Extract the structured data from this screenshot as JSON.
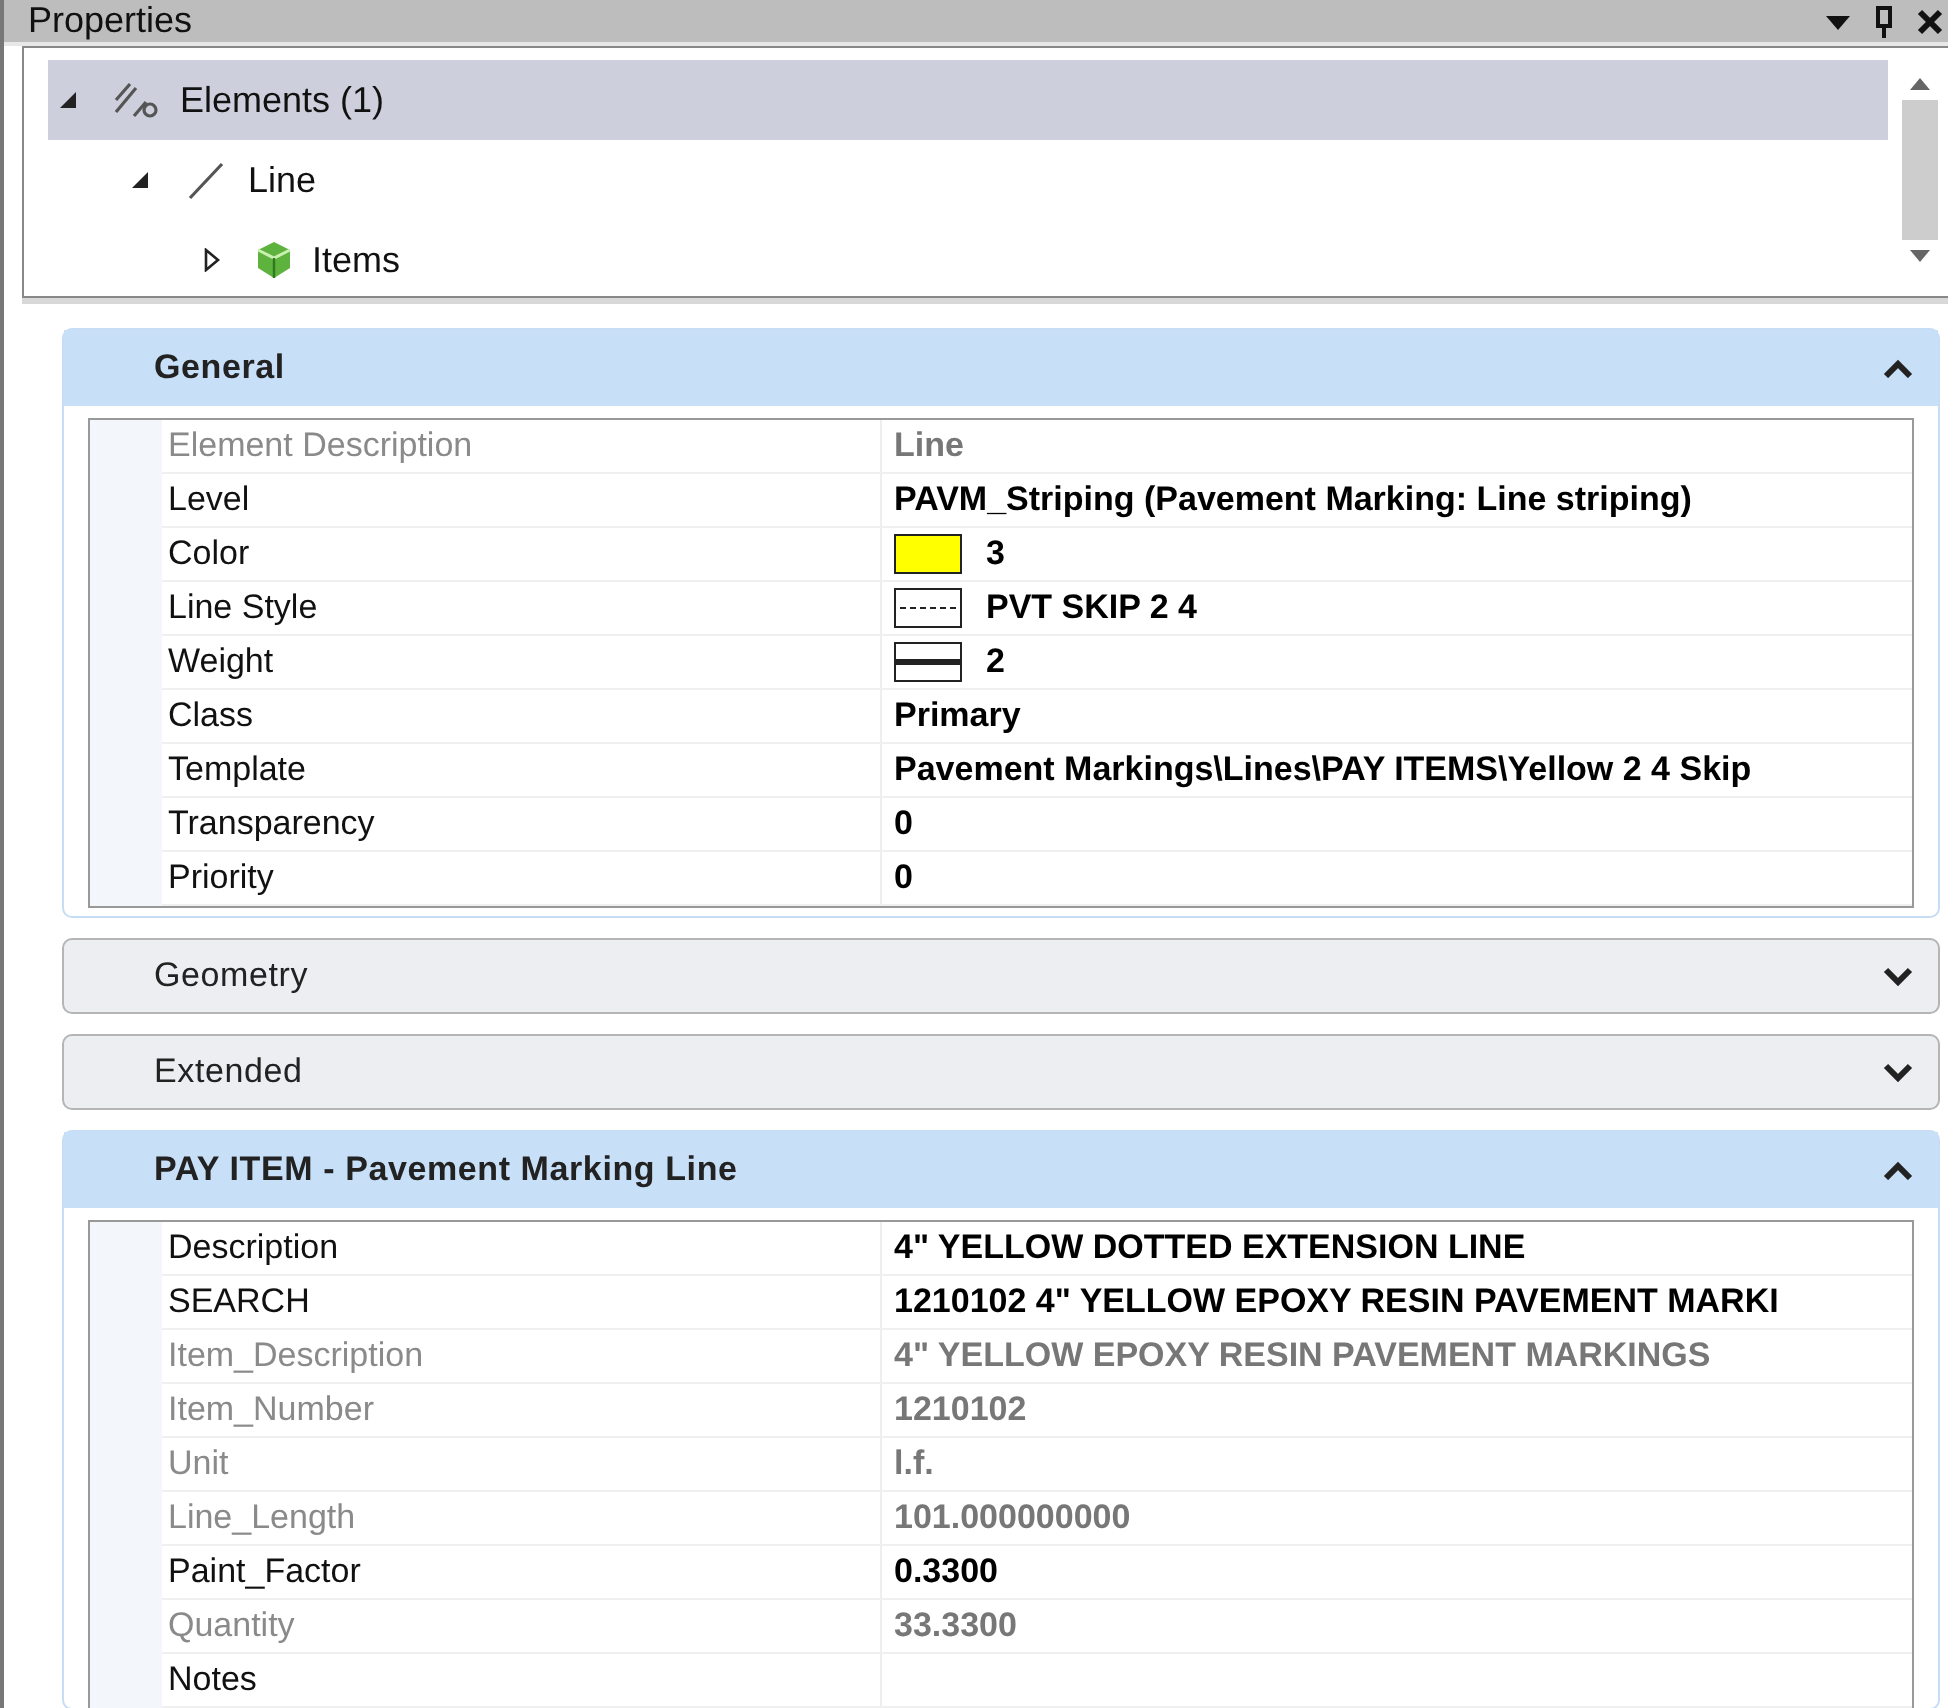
{
  "window": {
    "title": "Properties"
  },
  "tree": [
    {
      "label": "Elements (1)",
      "expanded": true,
      "selected": true,
      "children": [
        {
          "label": "Line",
          "expanded": true,
          "selected": false,
          "children": [
            {
              "label": "Items",
              "expanded": false,
              "selected": false
            }
          ]
        }
      ]
    }
  ],
  "sections": [
    {
      "title": "General",
      "expanded": true,
      "rows": [
        {
          "kind": "text",
          "name": "Element Description",
          "value": "Line",
          "disabled": true
        },
        {
          "kind": "text",
          "name": "Level",
          "value": "PAVM_Striping (Pavement Marking: Line striping)",
          "disabled": false
        },
        {
          "kind": "color",
          "name": "Color",
          "value": "3",
          "color": "#ffff00",
          "disabled": false
        },
        {
          "kind": "linestyle",
          "name": "Line Style",
          "value": "PVT SKIP 2 4",
          "disabled": false
        },
        {
          "kind": "weight",
          "name": "Weight",
          "value": "2",
          "disabled": false
        },
        {
          "kind": "text",
          "name": "Class",
          "value": "Primary",
          "disabled": false
        },
        {
          "kind": "text",
          "name": "Template",
          "value": "Pavement Markings\\Lines\\PAY ITEMS\\Yellow 2 4 Skip",
          "disabled": false
        },
        {
          "kind": "text",
          "name": "Transparency",
          "value": "0",
          "disabled": false
        },
        {
          "kind": "text",
          "name": "Priority",
          "value": "0",
          "disabled": false
        }
      ]
    },
    {
      "title": "Geometry",
      "expanded": false
    },
    {
      "title": "Extended",
      "expanded": false
    },
    {
      "title": "PAY ITEM - Pavement Marking Line",
      "expanded": true,
      "rows": [
        {
          "kind": "text",
          "name": "Description",
          "value": "4\" YELLOW DOTTED EXTENSION LINE",
          "disabled": false
        },
        {
          "kind": "text",
          "name": "SEARCH",
          "value": "1210102 4\" YELLOW EPOXY RESIN PAVEMENT MARKI",
          "disabled": false
        },
        {
          "kind": "text",
          "name": "Item_Description",
          "value": "4\" YELLOW EPOXY RESIN PAVEMENT MARKINGS",
          "disabled": true
        },
        {
          "kind": "text",
          "name": "Item_Number",
          "value": "1210102",
          "disabled": true
        },
        {
          "kind": "text",
          "name": "Unit",
          "value": "l.f.",
          "disabled": true
        },
        {
          "kind": "text",
          "name": "Line_Length",
          "value": "101.000000000",
          "disabled": true
        },
        {
          "kind": "text",
          "name": "Paint_Factor",
          "value": "0.3300",
          "disabled": false
        },
        {
          "kind": "text",
          "name": "Quantity",
          "value": "33.3300",
          "disabled": true
        },
        {
          "kind": "text",
          "name": "Notes",
          "disabled": false
        }
      ]
    }
  ]
}
